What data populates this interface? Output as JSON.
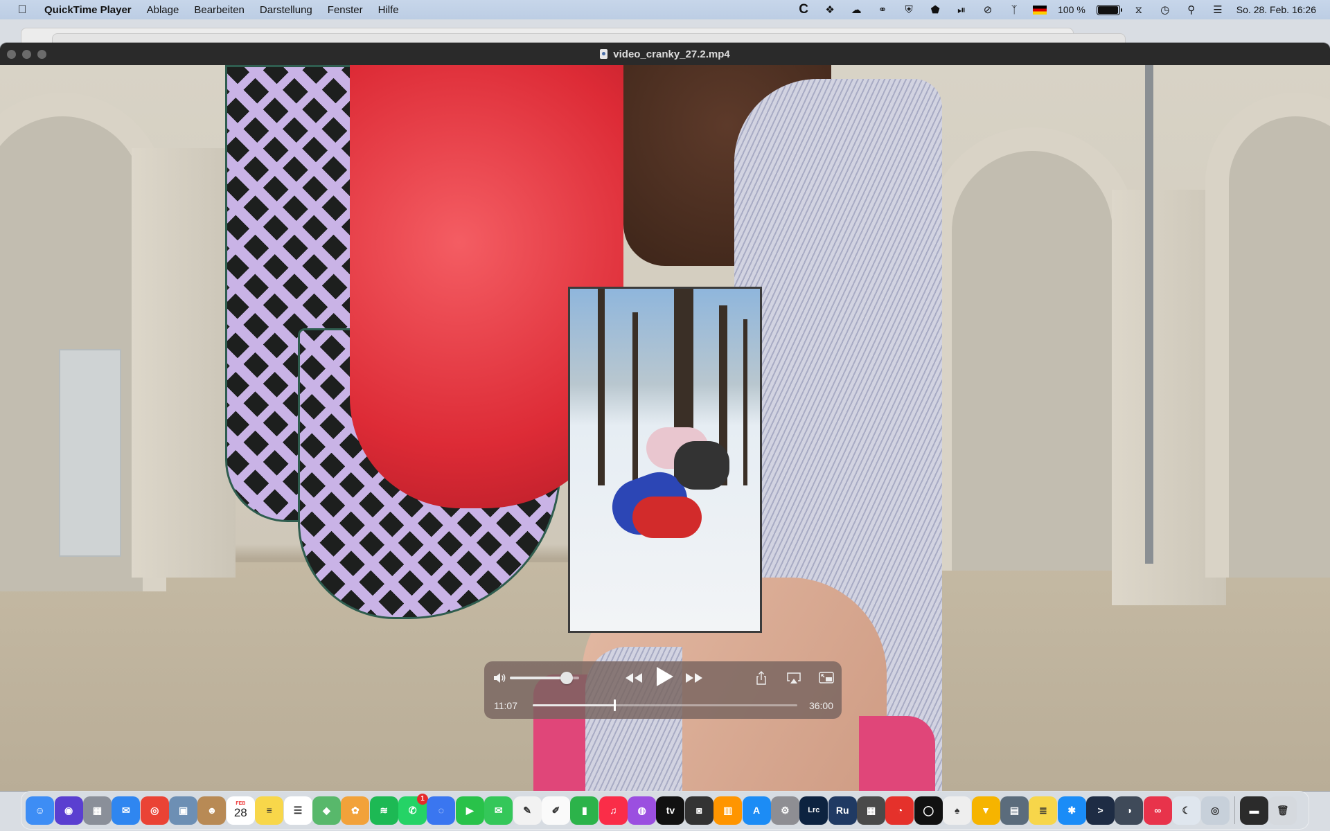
{
  "menubar": {
    "apple_icon": "apple-logo",
    "app_name": "QuickTime Player",
    "menus": [
      "Ablage",
      "Bearbeiten",
      "Darstellung",
      "Fenster",
      "Hilfe"
    ],
    "status_icons": [
      "c-app-icon",
      "dropbox-icon",
      "cloud-upload-icon",
      "creative-cloud-icon",
      "vpn-icon",
      "bitwarden-icon",
      "play-circle-icon",
      "mute-icon",
      "bluetooth-icon",
      "flag-germany-icon"
    ],
    "battery_text": "100 %",
    "battery_level": 1.0,
    "right_icons": [
      "wifi-icon",
      "time-machine-icon",
      "spotlight-search-icon",
      "control-center-icon"
    ],
    "clock": "So. 28. Feb.  16:26"
  },
  "window": {
    "title": "video_cranky_27.2.mp4",
    "traffic_lights": [
      "close",
      "minimize",
      "zoom"
    ]
  },
  "player": {
    "current_time": "11:07",
    "total_time": "36:00",
    "progress": 0.309,
    "volume_level": 0.82,
    "buttons": {
      "volume": "speaker-icon",
      "rewind": "rewind-icon",
      "play": "play-icon",
      "fast_forward": "fast-forward-icon",
      "share": "share-icon",
      "airplay": "airplay-icon",
      "pip": "picture-in-picture-icon"
    }
  },
  "dock": {
    "items": [
      {
        "name": "finder",
        "color": "#3d8df5",
        "glyph": "☺"
      },
      {
        "name": "siri",
        "color": "#5a3fd0",
        "glyph": "◉"
      },
      {
        "name": "launchpad",
        "color": "#8a8f99",
        "glyph": "▦"
      },
      {
        "name": "mail",
        "color": "#2f86f0",
        "glyph": "✉"
      },
      {
        "name": "chrome",
        "color": "#ea4335",
        "glyph": "◎"
      },
      {
        "name": "preview",
        "color": "#6d8fb4",
        "glyph": "▣"
      },
      {
        "name": "contacts",
        "color": "#b88a55",
        "glyph": "☻"
      },
      {
        "name": "calendar",
        "color": "#ffffff",
        "glyph": "28",
        "label": "FEB"
      },
      {
        "name": "notes",
        "color": "#f8d74a",
        "glyph": "≡"
      },
      {
        "name": "reminders",
        "color": "#ffffff",
        "glyph": "☰"
      },
      {
        "name": "maps",
        "color": "#58b86b",
        "glyph": "◆"
      },
      {
        "name": "photos",
        "color": "#f2a23a",
        "glyph": "✿"
      },
      {
        "name": "spotify",
        "color": "#1db954",
        "glyph": "≋"
      },
      {
        "name": "whatsapp",
        "color": "#25d366",
        "glyph": "✆",
        "badge": "1"
      },
      {
        "name": "signal",
        "color": "#3a76f0",
        "glyph": "◌"
      },
      {
        "name": "facetime",
        "color": "#29c24a",
        "glyph": "▶"
      },
      {
        "name": "messages",
        "color": "#34c759",
        "glyph": "✉"
      },
      {
        "name": "textedit",
        "color": "#f2f2f2",
        "glyph": "✎"
      },
      {
        "name": "freeform",
        "color": "#fafafa",
        "glyph": "✐"
      },
      {
        "name": "numbers",
        "color": "#2cb34a",
        "glyph": "▮"
      },
      {
        "name": "music",
        "color": "#fa2d48",
        "glyph": "♫"
      },
      {
        "name": "podcasts",
        "color": "#9b4fe0",
        "glyph": "◍"
      },
      {
        "name": "apple-tv",
        "color": "#111111",
        "glyph": "tv"
      },
      {
        "name": "screenshot",
        "color": "#333333",
        "glyph": "◙"
      },
      {
        "name": "books",
        "color": "#ff9500",
        "glyph": "▥"
      },
      {
        "name": "app-store",
        "color": "#1c8cf5",
        "glyph": "A"
      },
      {
        "name": "system-preferences",
        "color": "#8e8e93",
        "glyph": "⚙"
      },
      {
        "name": "lightroom-classic",
        "color": "#0d2340",
        "glyph": "Lrc"
      },
      {
        "name": "rush",
        "color": "#203a63",
        "glyph": "Ru"
      },
      {
        "name": "calculator",
        "color": "#4a4a4a",
        "glyph": "▦"
      },
      {
        "name": "istat-menus",
        "color": "#e5312b",
        "glyph": "◔"
      },
      {
        "name": "arc-app",
        "color": "#111111",
        "glyph": "◯"
      },
      {
        "name": "ace-app",
        "color": "#eeeeee",
        "glyph": "♠"
      },
      {
        "name": "keynote",
        "color": "#f6b400",
        "glyph": "▼"
      },
      {
        "name": "migration-assistant",
        "color": "#5b6c7c",
        "glyph": "▤"
      },
      {
        "name": "stickies",
        "color": "#f7d64a",
        "glyph": "≣"
      },
      {
        "name": "safari",
        "color": "#1a8cf7",
        "glyph": "✱"
      },
      {
        "name": "prompt",
        "color": "#1e2c44",
        "glyph": ">"
      },
      {
        "name": "proxyman",
        "color": "#3f4a59",
        "glyph": "◑"
      },
      {
        "name": "creative-cloud",
        "color": "#e8334b",
        "glyph": "∞"
      },
      {
        "name": "lasso",
        "color": "#dfe6ee",
        "glyph": "☾"
      },
      {
        "name": "camera-app",
        "color": "#c7d0da",
        "glyph": "◎"
      },
      {
        "name": "film-strip",
        "color": "#2b2b2b",
        "glyph": "▬"
      },
      {
        "name": "trash",
        "color": "#d5d9de",
        "glyph": "🗑"
      }
    ]
  }
}
